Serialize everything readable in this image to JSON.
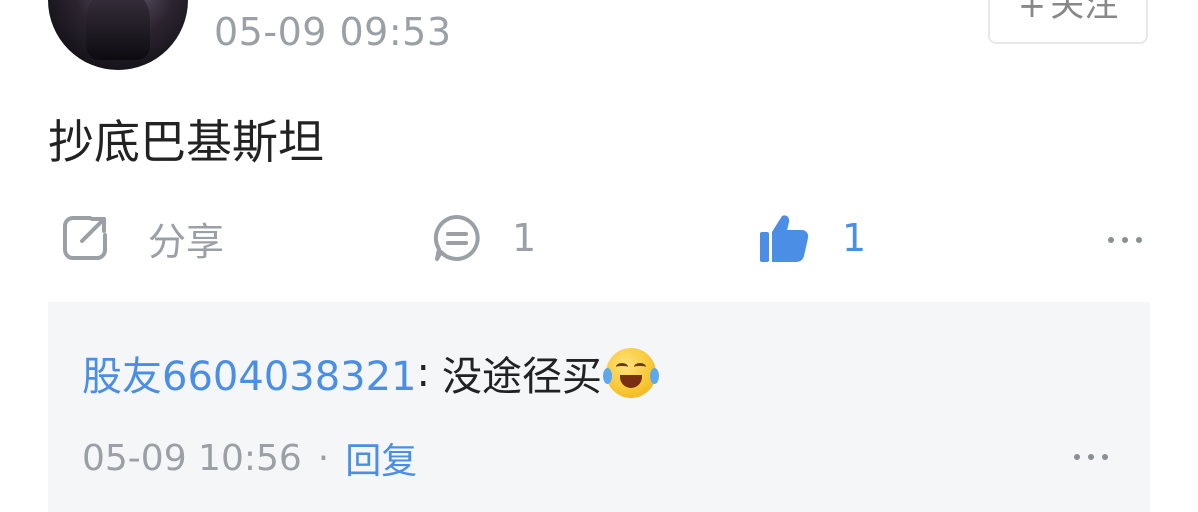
{
  "post": {
    "timestamp": "05-09 09:53",
    "follow_label": "关注",
    "follow_icon": "plus-icon",
    "text": "抄底巴基斯坦"
  },
  "actions": {
    "share_label": "分享",
    "comment_count": "1",
    "like_count": "1"
  },
  "icons": {
    "share": "share-icon",
    "comment": "comment-icon",
    "like": "thumbs-up-icon",
    "more": "more-icon",
    "emoji": "laughing-crying-emoji"
  },
  "reply": {
    "user": "股友6604038321",
    "separator": ":",
    "text": "没途径买",
    "timestamp": "05-09 10:56",
    "dot": "·",
    "reply_label": "回复"
  },
  "colors": {
    "link_blue": "#4a8ee6",
    "meta_gray": "#9aa0a6",
    "reply_bg": "#f5f6f8"
  }
}
